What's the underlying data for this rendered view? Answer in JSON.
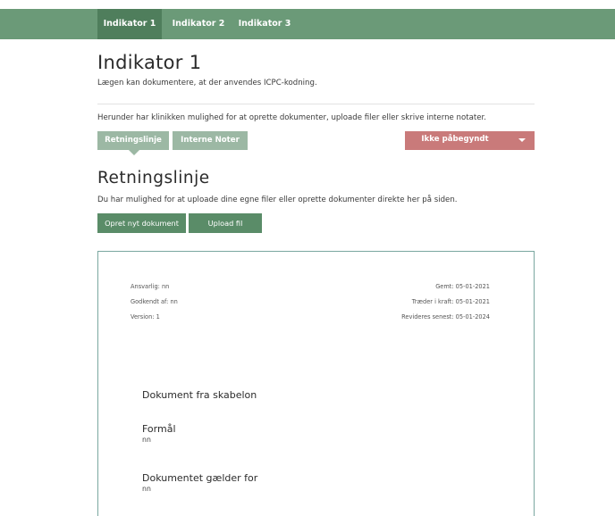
{
  "topnav": {
    "tabs": [
      {
        "label": "Indikator 1"
      },
      {
        "label": "Indikator 2"
      },
      {
        "label": "Indikator 3"
      }
    ]
  },
  "header": {
    "title": "Indikator 1",
    "subtitle": "Lægen kan dokumentere, at der anvendes ICPC-kodning."
  },
  "intro": "Herunder har klinikken mulighed for at oprette dokumenter, uploade filer eller skrive interne notater.",
  "subtabs": [
    {
      "label": "Retningslinje"
    },
    {
      "label": "Interne Noter"
    }
  ],
  "status": {
    "label": "Ikke påbegyndt"
  },
  "section": {
    "title": "Retningslinje",
    "description": "Du har mulighed for at uploade dine egne filer eller oprette dokumenter direkte her på siden."
  },
  "buttons": {
    "create": "Opret nyt dokument",
    "upload": "Upload fil"
  },
  "document": {
    "meta_left": [
      "Ansvarlig: nn",
      "Godkendt af: nn",
      "Version: 1"
    ],
    "meta_right": [
      "Gemt: 05-01-2021",
      "Træder i kraft: 05-01-2021",
      "Revideres senest: 05-01-2024"
    ],
    "heading": "Dokument fra skabelon",
    "sections": [
      {
        "title": "Formål",
        "value": "nn"
      },
      {
        "title": "Dokumentet gælder for",
        "value": "nn"
      }
    ]
  },
  "colors": {
    "nav": "#6b9a78",
    "nav_active": "#4f7e5c",
    "subtab": "#9cb8a4",
    "button": "#5a8c68",
    "status": "#c97a7a",
    "doc_border": "#7aa7a0"
  }
}
